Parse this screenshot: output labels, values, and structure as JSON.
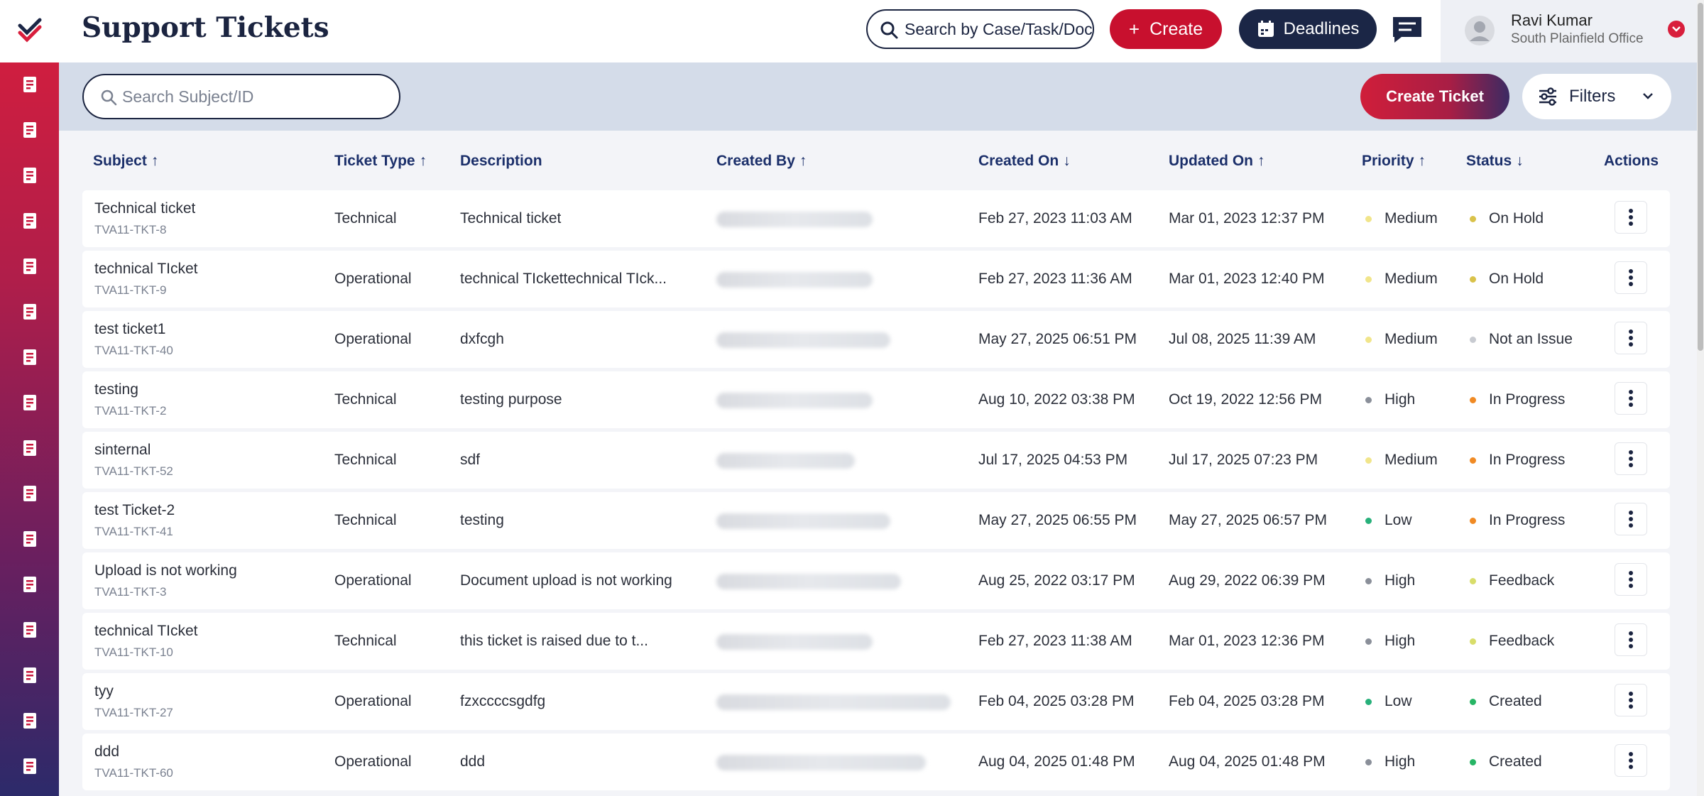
{
  "header": {
    "title": "Support Tickets",
    "global_search_placeholder": "Search by Case/Task/Docu",
    "create_label": "Create",
    "deadlines_label": "Deadlines",
    "user": {
      "name": "Ravi Kumar",
      "office": "South Plainfield Office"
    }
  },
  "toolbar": {
    "search_placeholder": "Search Subject/ID",
    "create_ticket_label": "Create Ticket",
    "filters_label": "Filters"
  },
  "sidebar": {
    "icons": [
      "dashboard-icon",
      "document-icon",
      "document-check-icon",
      "cases-icon",
      "tasks-icon",
      "messages-icon",
      "ledger-icon",
      "notes-icon",
      "billing-icon",
      "clipboard-icon",
      "contact-icon",
      "team-icon",
      "folder-icon",
      "forms-icon",
      "support-icon",
      "reports-icon"
    ]
  },
  "columns": [
    {
      "label": "Subject",
      "arrow": "↑"
    },
    {
      "label": "Ticket Type",
      "arrow": "↑"
    },
    {
      "label": "Description",
      "arrow": ""
    },
    {
      "label": "Created By",
      "arrow": "↑"
    },
    {
      "label": "Created On",
      "arrow": "↓"
    },
    {
      "label": "Updated On",
      "arrow": "↑"
    },
    {
      "label": "Priority",
      "arrow": "↑"
    },
    {
      "label": "Status",
      "arrow": "↓"
    },
    {
      "label": "Actions",
      "arrow": ""
    }
  ],
  "colors": {
    "priority": {
      "Medium": "#f1e58a",
      "High": "#8a8f99",
      "Low": "#27b07a"
    },
    "status": {
      "On Hold": "#d9c24a",
      "Not an Issue": "#c8cbd1",
      "In Progress": "#f08a24",
      "Feedback": "#d8dd6a",
      "Created": "#27b565"
    }
  },
  "rows": [
    {
      "subject": "Technical ticket",
      "id": "TVA11-TKT-8",
      "type": "Technical",
      "description": "Technical ticket",
      "created_on": "Feb 27, 2023 11:03 AM",
      "updated_on": "Mar 01, 2023 12:37 PM",
      "priority": "Medium",
      "status": "On Hold"
    },
    {
      "subject": "technical TIcket",
      "id": "TVA11-TKT-9",
      "type": "Operational",
      "description": "technical TIckettechnical TIck...",
      "created_on": "Feb 27, 2023 11:36 AM",
      "updated_on": "Mar 01, 2023 12:40 PM",
      "priority": "Medium",
      "status": "On Hold"
    },
    {
      "subject": "test ticket1",
      "id": "TVA11-TKT-40",
      "type": "Operational",
      "description": "dxfcgh",
      "created_on": "May 27, 2025 06:51 PM",
      "updated_on": "Jul 08, 2025 11:39 AM",
      "priority": "Medium",
      "status": "Not an Issue"
    },
    {
      "subject": "testing",
      "id": "TVA11-TKT-2",
      "type": "Technical",
      "description": "testing purpose",
      "created_on": "Aug 10, 2022 03:38 PM",
      "updated_on": "Oct 19, 2022 12:56 PM",
      "priority": "High",
      "status": "In Progress"
    },
    {
      "subject": "sinternal",
      "id": "TVA11-TKT-52",
      "type": "Technical",
      "description": "sdf",
      "created_on": "Jul 17, 2025 04:53 PM",
      "updated_on": "Jul 17, 2025 07:23 PM",
      "priority": "Medium",
      "status": "In Progress"
    },
    {
      "subject": "test Ticket-2",
      "id": "TVA11-TKT-41",
      "type": "Technical",
      "description": "testing",
      "created_on": "May 27, 2025 06:55 PM",
      "updated_on": "May 27, 2025 06:57 PM",
      "priority": "Low",
      "status": "In Progress"
    },
    {
      "subject": "Upload is not working",
      "id": "TVA11-TKT-3",
      "type": "Operational",
      "description": "Document upload is not working",
      "created_on": "Aug 25, 2022 03:17 PM",
      "updated_on": "Aug 29, 2022 06:39 PM",
      "priority": "High",
      "status": "Feedback"
    },
    {
      "subject": "technical TIcket",
      "id": "TVA11-TKT-10",
      "type": "Technical",
      "description": "this ticket is raised due to t...",
      "created_on": "Feb 27, 2023 11:38 AM",
      "updated_on": "Mar 01, 2023 12:36 PM",
      "priority": "High",
      "status": "Feedback"
    },
    {
      "subject": "tyy",
      "id": "TVA11-TKT-27",
      "type": "Operational",
      "description": "fzxccccsgdfg",
      "created_on": "Feb 04, 2025 03:28 PM",
      "updated_on": "Feb 04, 2025 03:28 PM",
      "priority": "Low",
      "status": "Created"
    },
    {
      "subject": "ddd",
      "id": "TVA11-TKT-60",
      "type": "Operational",
      "description": "ddd",
      "created_on": "Aug 04, 2025 01:48 PM",
      "updated_on": "Aug 04, 2025 01:48 PM",
      "priority": "High",
      "status": "Created"
    }
  ]
}
